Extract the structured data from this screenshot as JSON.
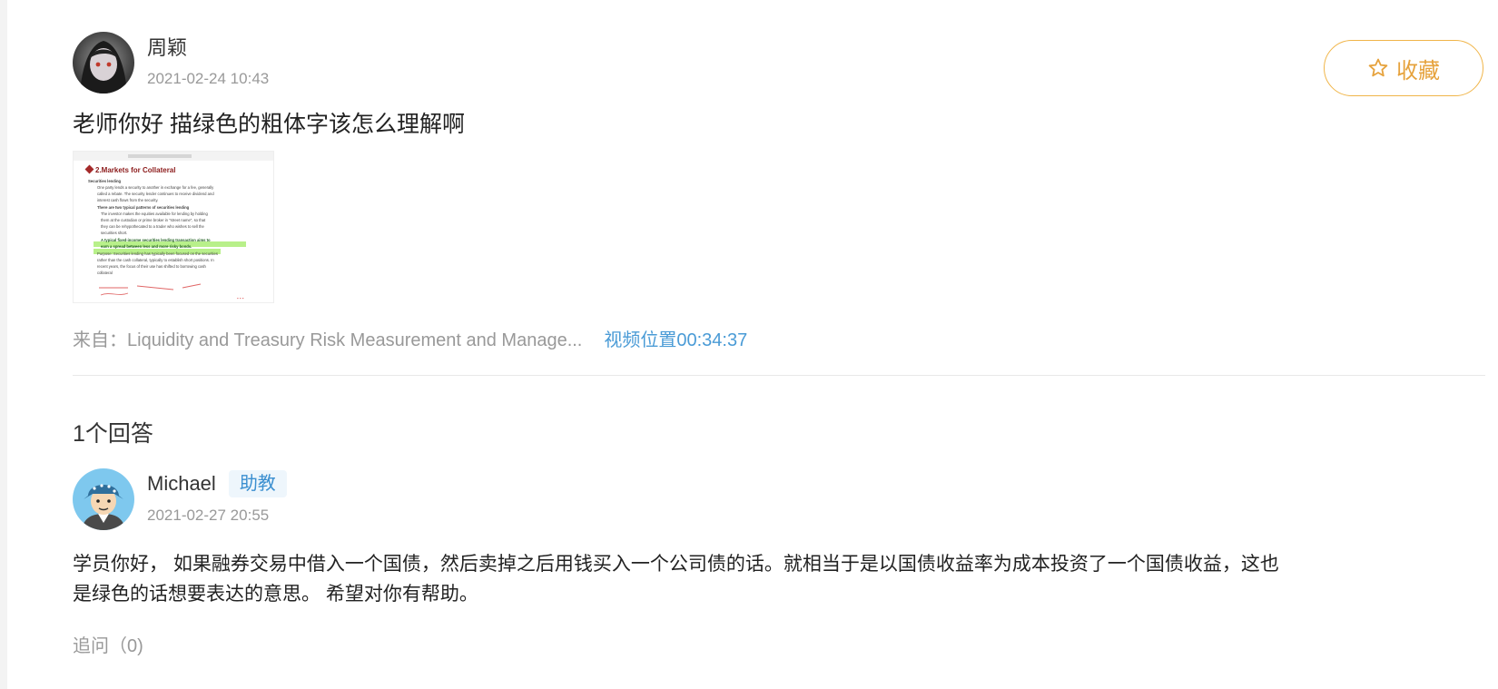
{
  "question": {
    "author": "周颖",
    "time": "2021-02-24 10:43",
    "text": "老师你好 描绿色的粗体字该怎么理解啊",
    "favorite_label": "收藏",
    "thumbnail": {
      "title": "2.Markets for Collateral",
      "lines": [
        "Securities lending",
        "One party lends a security to another in exchange for a fee, generally",
        "called a rebate. The security lender continues to receive dividend and",
        "interest cash flows from the security.",
        "There are two typical patterns of securities lending",
        "The investor makes the equities available for lending by holding",
        "them at the custodian or prime broker in \"street name\", so that",
        "they can be rehypothecated to a trader who wishes to sell the",
        "securities short.",
        "A typical fixed-income securities lending transaction aims to",
        "earn a spread between less and more risky bonds.",
        "Purpose: Securities lending has typically been focused on the securities",
        "rather than the cash collateral, typically to establish short positions. In",
        "recent years, the focus of their use has shifted to borrowing cash",
        "collateral"
      ]
    },
    "source_label": "来自：Liquidity and Treasury Risk Measurement and Manage...",
    "video_position": "视频位置00:34:37"
  },
  "answers_count": "1个回答",
  "answer": {
    "author": "Michael",
    "badge": "助教",
    "time": "2021-02-27 20:55",
    "text": "学员你好， 如果融券交易中借入一个国债，然后卖掉之后用钱买入一个公司债的话。就相当于是以国债收益率为成本投资了一个国债收益，这也是绿色的话想要表达的意思。 希望对你有帮助。",
    "followup": "追问（0)"
  },
  "colors": {
    "accent_orange": "#e6a23c",
    "link_blue": "#4a9bd6",
    "badge_bg": "#eef6fc"
  }
}
